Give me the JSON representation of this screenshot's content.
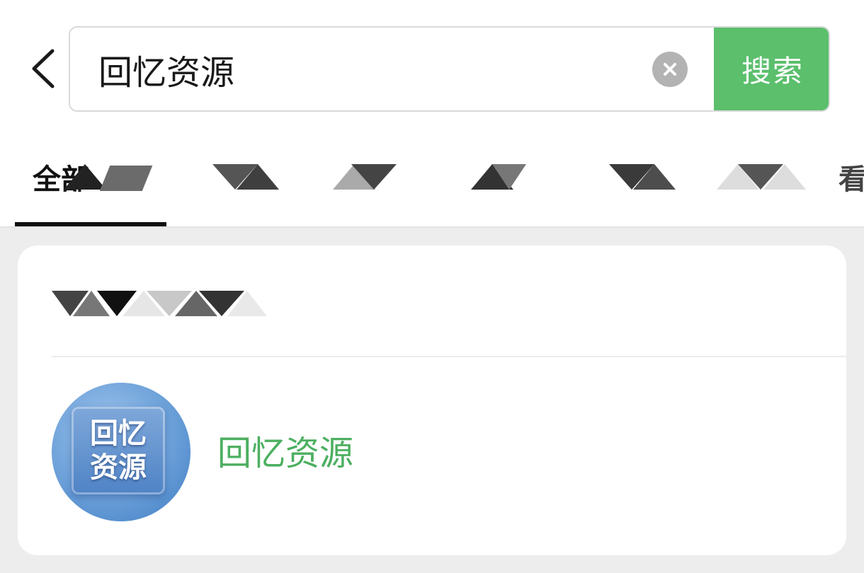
{
  "search": {
    "query": "回忆资源",
    "button_label": "搜索"
  },
  "tabs": [
    {
      "label": "全部",
      "active": true
    }
  ],
  "tabs_partial_last": "看",
  "result": {
    "name": "回忆资源",
    "avatar_line1": "回忆",
    "avatar_line2": "资源"
  },
  "colors": {
    "accent_green": "#5bbf6c",
    "result_name_green": "#4caf60",
    "clear_grey": "#b3b3b3",
    "page_bg": "#ededed"
  },
  "icons": {
    "back": "chevron-left-icon",
    "clear": "close-circle-icon"
  }
}
